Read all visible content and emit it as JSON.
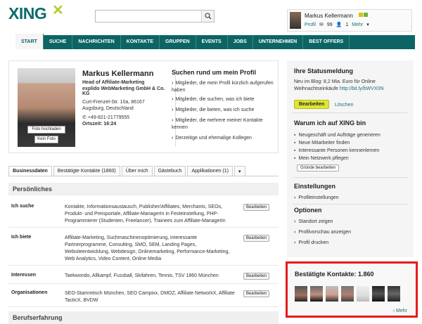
{
  "brand": {
    "logo": "XING",
    "accent": "#0c6564",
    "highlight": "#dfe534"
  },
  "user": {
    "name": "Markus Kellermann",
    "links": [
      "Profil",
      "99",
      "1",
      "Mehr"
    ]
  },
  "nav": [
    "START",
    "SUCHE",
    "NACHRICHTEN",
    "KONTAKTE",
    "GRUPPEN",
    "EVENTS",
    "JOBS",
    "UNTERNEHMEN",
    "BEST OFFERS"
  ],
  "profile": {
    "name": "Markus Kellermann",
    "title": "Head of Affiliate-Marketing",
    "company": "explido WebMarketing GmbH & Co. KG",
    "street": "Curt-Frenzel-Str. 10a, 86167",
    "city": "Augsburg, Deutschland",
    "phone": "+49-821-21779555",
    "time": "Ortszeit: 16:24",
    "upload_btn": "Foto hochladen",
    "nophoto_btn": "Kein Foto"
  },
  "suchen": {
    "title": "Suchen rund um mein Profil",
    "items": [
      "Mitglieder, die mein Profil kürzlich aufgerufen haben",
      "Mitglieder, die suchen, was ich biete",
      "Mitglieder, die bieten, was ich suche",
      "Mitglieder, die mehrere meiner Kontakte kennen",
      "Derzeitige und ehemalige Kollegen"
    ]
  },
  "tabs": [
    "Businessdaten",
    "Bestätigte Kontakte (1860)",
    "Über mich",
    "Gästebuch",
    "Applikationen (1)",
    "▾"
  ],
  "sections": {
    "personal": "Persönliches",
    "career": "Berufserfahrung"
  },
  "rows": [
    {
      "label": "Ich suche",
      "text": "Kontakte, Informationsaustausch, Publisher/Affiliates, Merchants, SEOs, Produkt- und Preisportale, Affiliate-ManagerIn in Festeinstellung, PHP-Programmierer (Studenten, Freelancer), Trainees zum Affiliate-ManagerIn",
      "btn": "Bearbeiten"
    },
    {
      "label": "Ich biete",
      "text": "Affiliate-Marketing, Suchmaschinenoptimierung, interessante Partnerprogramme, Consulting, SMO, SEM, Landing Pages, Websiteentwicklung, Webdesign, Onlinemarketing, Performance-Marketing, Web Analytics, Video Content, Online Media",
      "btn": "Bearbeiten"
    },
    {
      "label": "Interessen",
      "text": "Taekwondo, Allkampf, Fussball, Skifahren, Tennis, TSV 1860 München",
      "btn": "Bearbeiten"
    },
    {
      "label": "Organisationen",
      "text": "SEO-Stammtisch München, SEO Campixx, DMOZ, Affiliate NetworkX, Affiliate TacticX, BVDW",
      "btn": "Bearbeiten"
    }
  ],
  "right": {
    "status_title": "Ihre Statusmeldung",
    "status_text": "Neu im Blog: 8,2 Mia. Euro für Online Weihnachtseinkäufe",
    "status_link": "http://bit.ly/bWVX0N",
    "save_btn": "Bearbeiten",
    "delete": "Löschen",
    "why_title": "Warum ich auf XING bin",
    "why": [
      "Neugeschäft und Aufträge generieren",
      "Neue Mitarbeiter finden",
      "Interessante Personen kennenlernen",
      "Mein Netzwerk pflegen"
    ],
    "why_btn": "Gründe bearbeiten",
    "settings_title": "Einstellungen",
    "settings": [
      "Profileinstellungen"
    ],
    "options_title": "Optionen",
    "options": [
      "Standort zeigen",
      "Profilvorschau anzeigen",
      "Profil drucken"
    ]
  },
  "contacts": {
    "title": "Bestätigte Kontakte: 1.860",
    "more": "Mehr"
  }
}
